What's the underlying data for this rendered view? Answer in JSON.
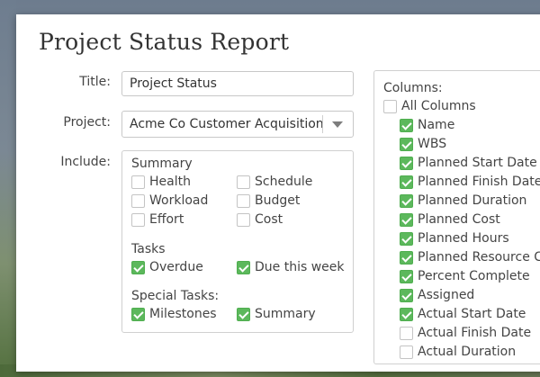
{
  "dialog": {
    "title": "Project Status Report"
  },
  "form": {
    "title_label": "Title:",
    "title_value": "Project Status",
    "project_label": "Project:",
    "project_value": "Acme Co Customer Acquisition",
    "include_label": "Include:"
  },
  "include": {
    "summary_label": "Summary",
    "summary_items": [
      {
        "label": "Health",
        "checked": false
      },
      {
        "label": "Schedule",
        "checked": false
      },
      {
        "label": "Workload",
        "checked": false
      },
      {
        "label": "Budget",
        "checked": false
      },
      {
        "label": "Effort",
        "checked": false
      },
      {
        "label": "Cost",
        "checked": false
      }
    ],
    "tasks_label": "Tasks",
    "tasks_items": [
      {
        "label": "Overdue",
        "checked": true
      },
      {
        "label": "Due this week",
        "checked": true
      }
    ],
    "special_label": "Special Tasks:",
    "special_items": [
      {
        "label": "Milestones",
        "checked": true
      },
      {
        "label": "Summary",
        "checked": true
      }
    ]
  },
  "columns": {
    "label": "Columns:",
    "all": {
      "label": "All Columns",
      "checked": false
    },
    "items": [
      {
        "label": "Name",
        "checked": true
      },
      {
        "label": "WBS",
        "checked": true
      },
      {
        "label": "Planned Start Date",
        "checked": true
      },
      {
        "label": "Planned Finish Date",
        "checked": true
      },
      {
        "label": "Planned Duration",
        "checked": true
      },
      {
        "label": "Planned Cost",
        "checked": true
      },
      {
        "label": "Planned Hours",
        "checked": true
      },
      {
        "label": "Planned Resource Co",
        "checked": true
      },
      {
        "label": "Percent Complete",
        "checked": true
      },
      {
        "label": "Assigned",
        "checked": true
      },
      {
        "label": "Actual Start Date",
        "checked": true
      },
      {
        "label": "Actual Finish Date",
        "checked": false
      },
      {
        "label": "Actual Duration",
        "checked": false
      }
    ]
  },
  "colors": {
    "checkbox_checked": "#5cb85c"
  }
}
